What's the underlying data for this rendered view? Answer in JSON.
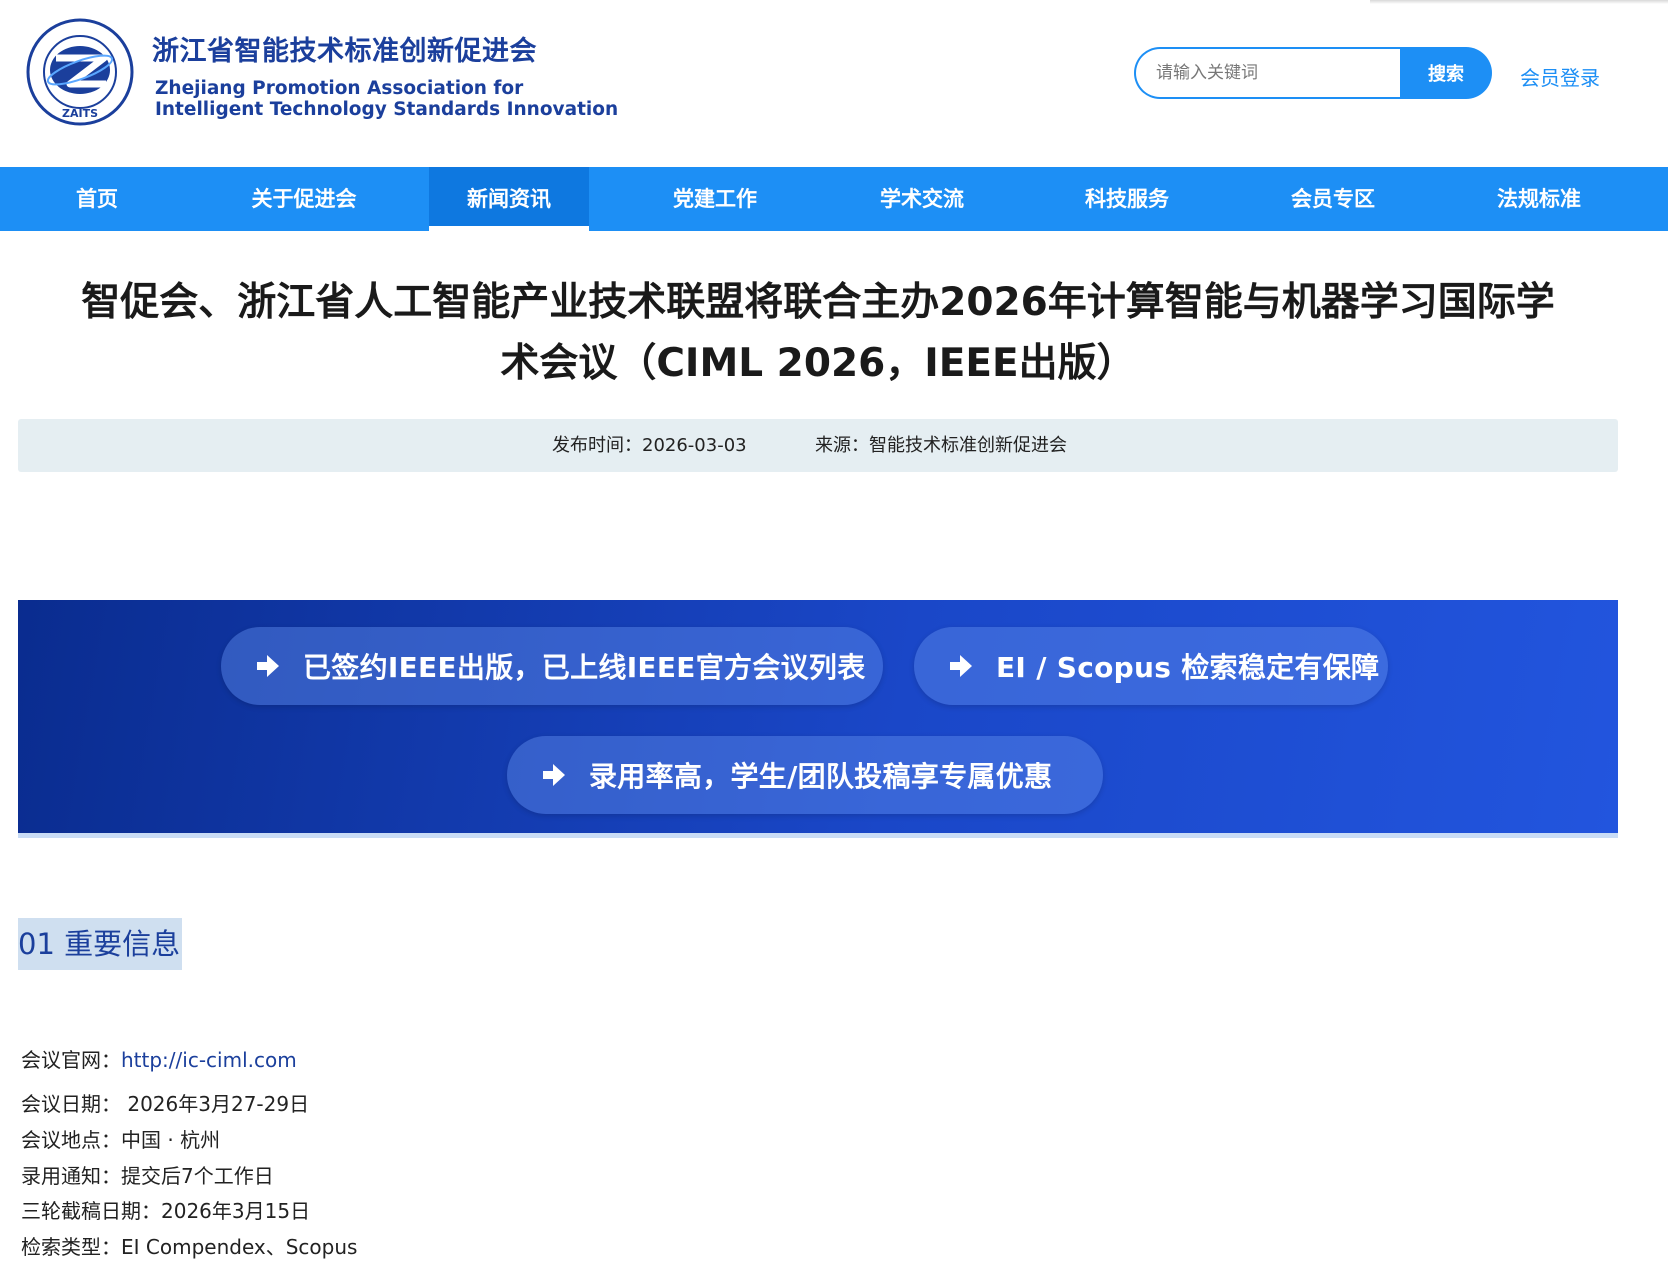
{
  "header": {
    "logo_text": "ZAITS",
    "logo_ring_text": "浙江省智能技术标准创新促进会",
    "brand_cn": "浙江省智能技术标准创新促进会",
    "brand_en_line1": "Zhejiang Promotion Association for",
    "brand_en_line2": "Intelligent Technology Standards Innovation",
    "search_placeholder": "请输入关键词",
    "search_button": "搜索",
    "login": "会员登录"
  },
  "nav": {
    "items": [
      {
        "label": "首页"
      },
      {
        "label": "关于促进会"
      },
      {
        "label": "新闻资讯",
        "active": true
      },
      {
        "label": "党建工作"
      },
      {
        "label": "学术交流"
      },
      {
        "label": "科技服务"
      },
      {
        "label": "会员专区"
      },
      {
        "label": "法规标准"
      }
    ]
  },
  "article": {
    "title_line1": "智促会、浙江省人工智能产业技术联盟将联合主办2026年计算智能与机器学习国际学",
    "title_line2": "术会议（CIML 2026，IEEE出版）",
    "publish_label": "发布时间：",
    "publish_date": "2026-03-03",
    "source_label": "来源：",
    "source": "智能技术标准创新促进会"
  },
  "banner": {
    "pills": [
      "已签约IEEE出版，已上线IEEE官方会议列表",
      "EI / Scopus 检索稳定有保障",
      "录用率高，学生/团队投稿享专属优惠"
    ]
  },
  "section": {
    "heading": "01  重要信息"
  },
  "info": {
    "website_label": "会议官网：",
    "website": "http://ic-ciml.com",
    "date_label": "会议日期：",
    "date": " 2026年3月27-29日",
    "location_label": "会议地点：",
    "location": "中国 · 杭州",
    "notice_label": "录用通知：",
    "notice": "提交后7个工作日",
    "deadline_label": "三轮截稿日期：",
    "deadline": "2026年3月15日",
    "index_label": "检索类型：",
    "index": "EI Compendex、Scopus"
  },
  "colors": {
    "nav_blue": "#1d8ff5",
    "brand_navy": "#1b3f9c",
    "banner_dark": "#0a2c8f",
    "banner_light": "#2255de"
  }
}
